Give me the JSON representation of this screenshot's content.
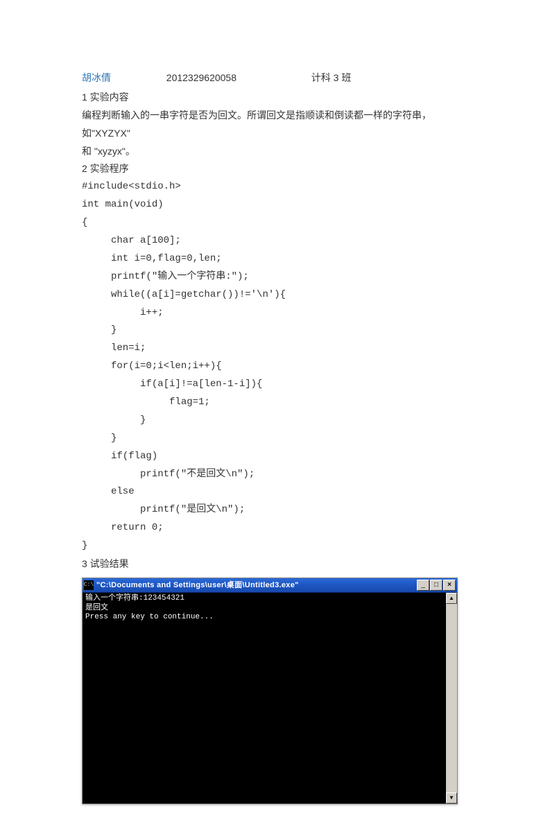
{
  "header": {
    "name": "胡冰倩",
    "student_id": "2012329620058",
    "class": "计科 3 班"
  },
  "sections": {
    "s1_title": "1 实验内容",
    "s1_body_1": "编程判断输入的一串字符是否为回文。所谓回文是指顺读和倒读都一样的字符串，如\"XYZYX\"",
    "s1_body_2": "和 \"xyzyx\"。",
    "s2_title": "2 实验程序",
    "s3_title": "3 试验结果"
  },
  "code": "#include<stdio.h>\nint main(void)\n{\n     char a[100];\n     int i=0,flag=0,len;\n     printf(\"输入一个字符串:\");\n     while((a[i]=getchar())!='\\n'){\n          i++;\n     }\n     len=i;\n     for(i=0;i<len;i++){\n          if(a[i]!=a[len-1-i]){\n               flag=1;\n          }\n     }\n     if(flag)\n          printf(\"不是回文\\n\");\n     else\n          printf(\"是回文\\n\");\n     return 0;\n}",
  "console": {
    "title": "\"C:\\Documents and Settings\\user\\桌面\\Untitled3.exe\"",
    "icon_text": "C:\\",
    "output": "输入一个字符串:123454321\n是回文\nPress any key to continue...",
    "buttons": {
      "minimize": "_",
      "maximize": "□",
      "close": "×",
      "scroll_up": "▲",
      "scroll_down": "▼"
    }
  }
}
